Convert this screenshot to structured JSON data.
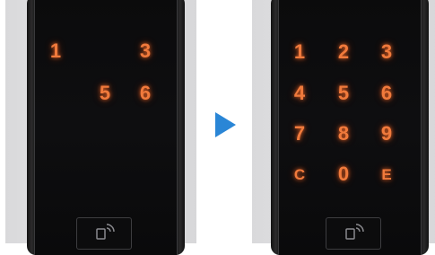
{
  "left_lock": {
    "keys": [
      {
        "label": "1",
        "pos": "r1c1"
      },
      {
        "label": "3",
        "pos": "r1c3"
      },
      {
        "label": "5",
        "pos": "r2c2"
      },
      {
        "label": "6",
        "pos": "r2c3"
      }
    ],
    "nfc_icon": "nfc-card-icon"
  },
  "right_lock": {
    "keys": [
      {
        "label": "1"
      },
      {
        "label": "2"
      },
      {
        "label": "3"
      },
      {
        "label": "4"
      },
      {
        "label": "5"
      },
      {
        "label": "6"
      },
      {
        "label": "7"
      },
      {
        "label": "8"
      },
      {
        "label": "9"
      },
      {
        "label": "C"
      },
      {
        "label": "0"
      },
      {
        "label": "E"
      }
    ],
    "nfc_icon": "nfc-card-icon"
  },
  "arrow": {
    "icon": "play-arrow-icon",
    "color": "#2a86d6"
  },
  "colors": {
    "key_glow": "#f07a3c",
    "lock_body": "#0b0b0c",
    "background": "#e2e2e4"
  }
}
